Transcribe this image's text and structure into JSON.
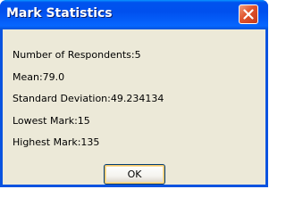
{
  "window": {
    "title": "Mark Statistics"
  },
  "stats": [
    "Number of Respondents:5",
    "Mean:79.0",
    "Standard Deviation:49.234134",
    "Lowest Mark:15",
    "Highest Mark:135"
  ],
  "buttons": {
    "ok_label": "OK"
  },
  "colors": {
    "titlebar": "#0053ee",
    "close_button": "#e0532c",
    "client_background": "#ece9d8"
  },
  "icons": {
    "close": "close-icon"
  }
}
